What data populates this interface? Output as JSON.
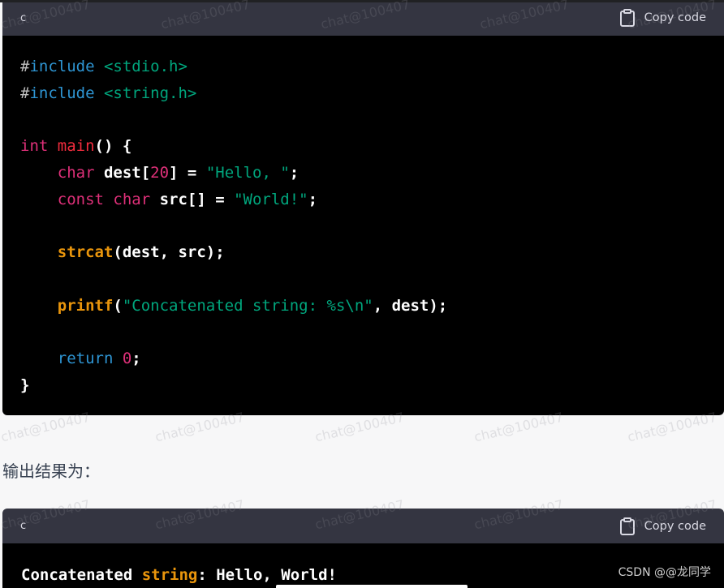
{
  "watermark": "chat@100407",
  "theme": {
    "page_bg": "#f7f7f8",
    "header_bg": "#343541",
    "code_bg": "#000000",
    "header_text": "#d9d9e3",
    "plain": "#ffffff",
    "meta": "#bfbfbf",
    "keyword": "#2e95d3",
    "string": "#00a67d",
    "type": "#df3079",
    "title": "#f22c3d",
    "number": "#df3079",
    "built_in": "#e9950c",
    "body_text": "#374151",
    "csdn_text": "#d0d0d0"
  },
  "code_block": {
    "language": "c",
    "copy_label": "Copy code",
    "copy_icon": "clipboard-icon",
    "lines": [
      [
        "#",
        "include",
        " <stdio.h>"
      ],
      [
        "#",
        "include",
        " <string.h>"
      ],
      [],
      [
        "int ",
        "main",
        "() {"
      ],
      [
        "    char ",
        "dest[",
        "20",
        "] = ",
        "\"Hello, \"",
        ";"
      ],
      [
        "    const char ",
        "src[] = ",
        "\"World!\"",
        ";"
      ],
      [],
      [
        "    strcat",
        "(dest, src);"
      ],
      [],
      [
        "    printf",
        "(",
        "\"Concatenated string: %s\\n\"",
        ", dest);"
      ],
      [],
      [
        "    return ",
        "0",
        ";"
      ],
      [
        "}"
      ]
    ]
  },
  "output_intro": "输出结果为：",
  "output_block": {
    "language": "c",
    "copy_label": "Copy code",
    "copy_icon": "clipboard-icon",
    "lines": [
      [
        "Concatenated ",
        "string",
        ": Hello, World!"
      ]
    ]
  },
  "csdn_watermark": "CSDN @@龙同学"
}
